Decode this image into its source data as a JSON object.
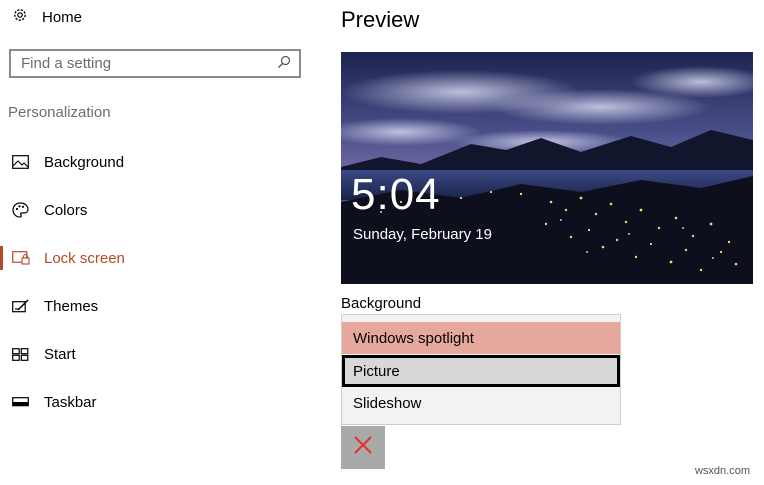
{
  "sidebar": {
    "home_label": "Home",
    "search_placeholder": "Find a setting",
    "section_label": "Personalization",
    "items": [
      {
        "label": "Background",
        "icon": "image-icon"
      },
      {
        "label": "Colors",
        "icon": "palette-icon"
      },
      {
        "label": "Lock screen",
        "icon": "lock-screen-icon",
        "active": true
      },
      {
        "label": "Themes",
        "icon": "themes-icon"
      },
      {
        "label": "Start",
        "icon": "start-icon"
      },
      {
        "label": "Taskbar",
        "icon": "taskbar-icon"
      }
    ]
  },
  "main": {
    "title": "Preview",
    "preview": {
      "time": "5:04",
      "date": "Sunday, February 19"
    },
    "background_label": "Background",
    "dropdown_options": [
      {
        "label": "Windows spotlight",
        "state": "highlighted"
      },
      {
        "label": "Picture",
        "state": "focused"
      },
      {
        "label": "Slideshow",
        "state": "normal"
      }
    ]
  },
  "watermark": "wsxdn.com",
  "colors": {
    "accent": "#b14c28",
    "option_highlight": "#e6a89c",
    "close_x": "#e0332b"
  }
}
